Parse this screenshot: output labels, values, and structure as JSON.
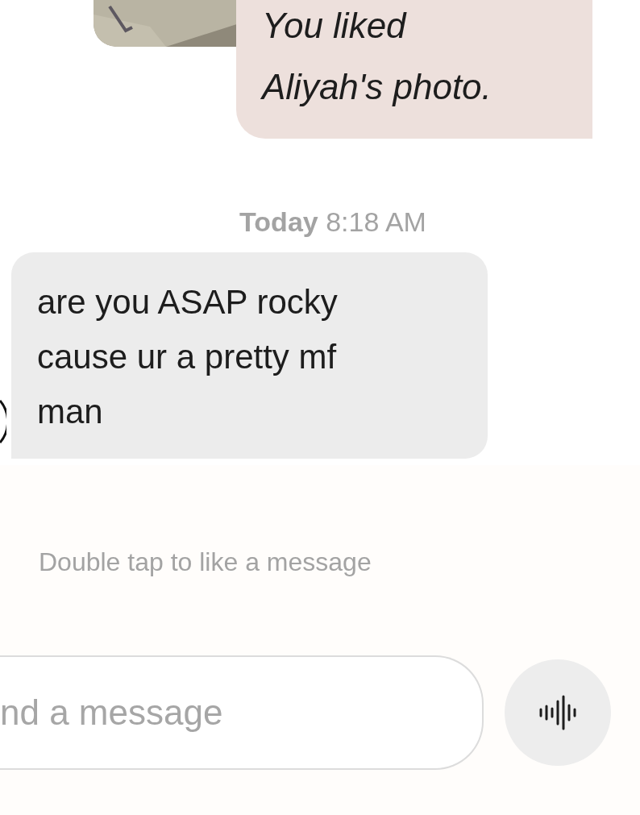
{
  "messages": [
    {
      "kind": "photo_like",
      "text": "You liked Aliyah's photo."
    },
    {
      "kind": "timestamp",
      "day": "Today",
      "time": "8:18 AM"
    },
    {
      "kind": "text",
      "from_me": false,
      "text": "are you ASAP rocky cause ur a pretty mf man"
    }
  ],
  "hint": "Double tap to like a message",
  "composer": {
    "placeholder": "nd a message"
  }
}
